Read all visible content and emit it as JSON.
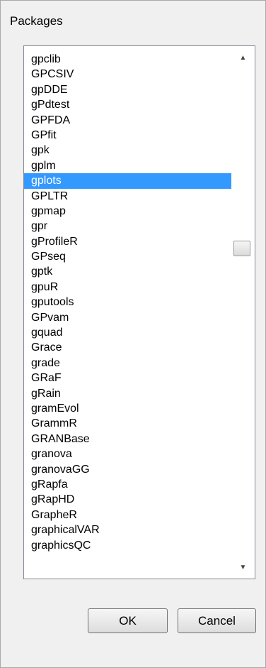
{
  "window": {
    "title": "Packages"
  },
  "list": {
    "items": [
      "gpclib",
      "GPCSIV",
      "gpDDE",
      "gPdtest",
      "GPFDA",
      "GPfit",
      "gpk",
      "gplm",
      "gplots",
      "GPLTR",
      "gpmap",
      "gpr",
      "gProfileR",
      "GPseq",
      "gptk",
      "gpuR",
      "gputools",
      "GPvam",
      "gquad",
      "Grace",
      "grade",
      "GRaF",
      "gRain",
      "gramEvol",
      "GrammR",
      "GRANBase",
      "granova",
      "granovaGG",
      "gRapfa",
      "gRapHD",
      "GrapheR",
      "graphicalVAR",
      "graphicsQC"
    ],
    "selected_item": "gplots",
    "selected_color": "#3399ff"
  },
  "scrollbar": {
    "up_icon": "chevron-up-icon",
    "down_icon": "chevron-down-icon"
  },
  "buttons": {
    "ok_label": "OK",
    "cancel_label": "Cancel"
  }
}
